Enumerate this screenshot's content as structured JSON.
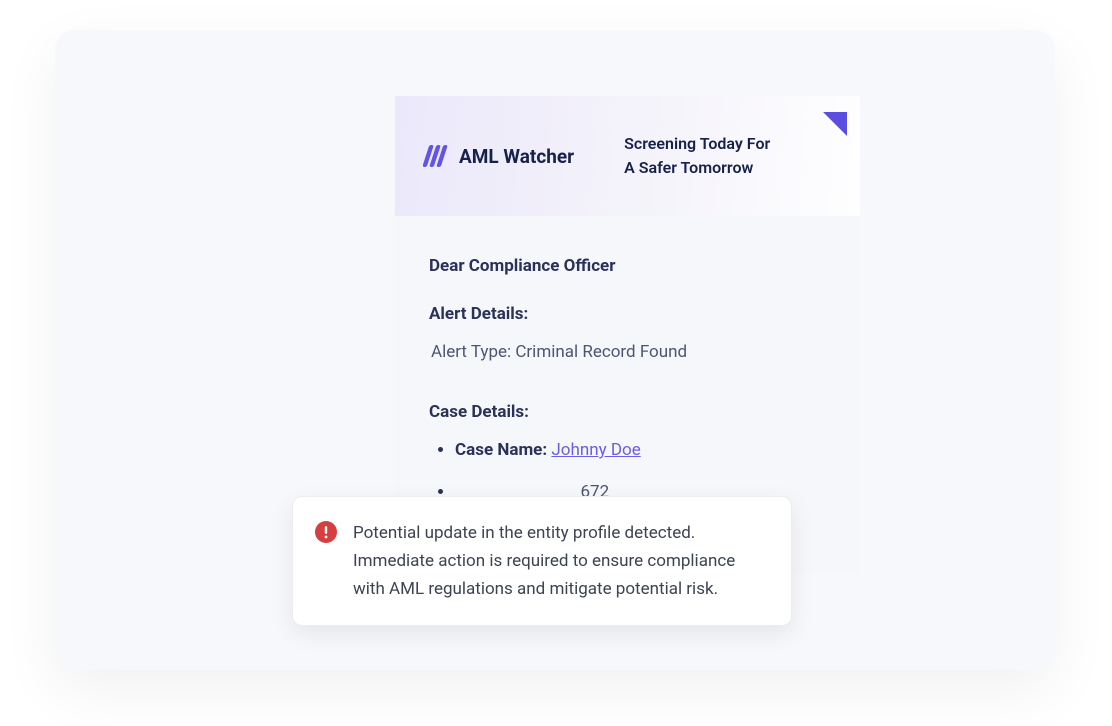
{
  "brand": {
    "name": "AML Watcher",
    "tagline_line1": "Screening Today For",
    "tagline_line2": "A Safer Tomorrow"
  },
  "email": {
    "greeting": "Dear Compliance Officer",
    "alert_details_heading": "Alert Details:",
    "alert_type_label": "Alert Type: ",
    "alert_type_value": "Criminal Record Found",
    "case_details_heading": "Case Details:",
    "case_name_label": "Case Name: ",
    "case_name_value": "Johnny Doe",
    "case_id_fragment": "672"
  },
  "toast": {
    "message": "Potential update in the entity profile detected. Immediate action is required to ensure compliance with AML regulations and mitigate potential risk."
  },
  "colors": {
    "accent": "#6b5ce5",
    "heading": "#2a3257",
    "body": "#4c5572",
    "alert": "#d63f3f"
  }
}
